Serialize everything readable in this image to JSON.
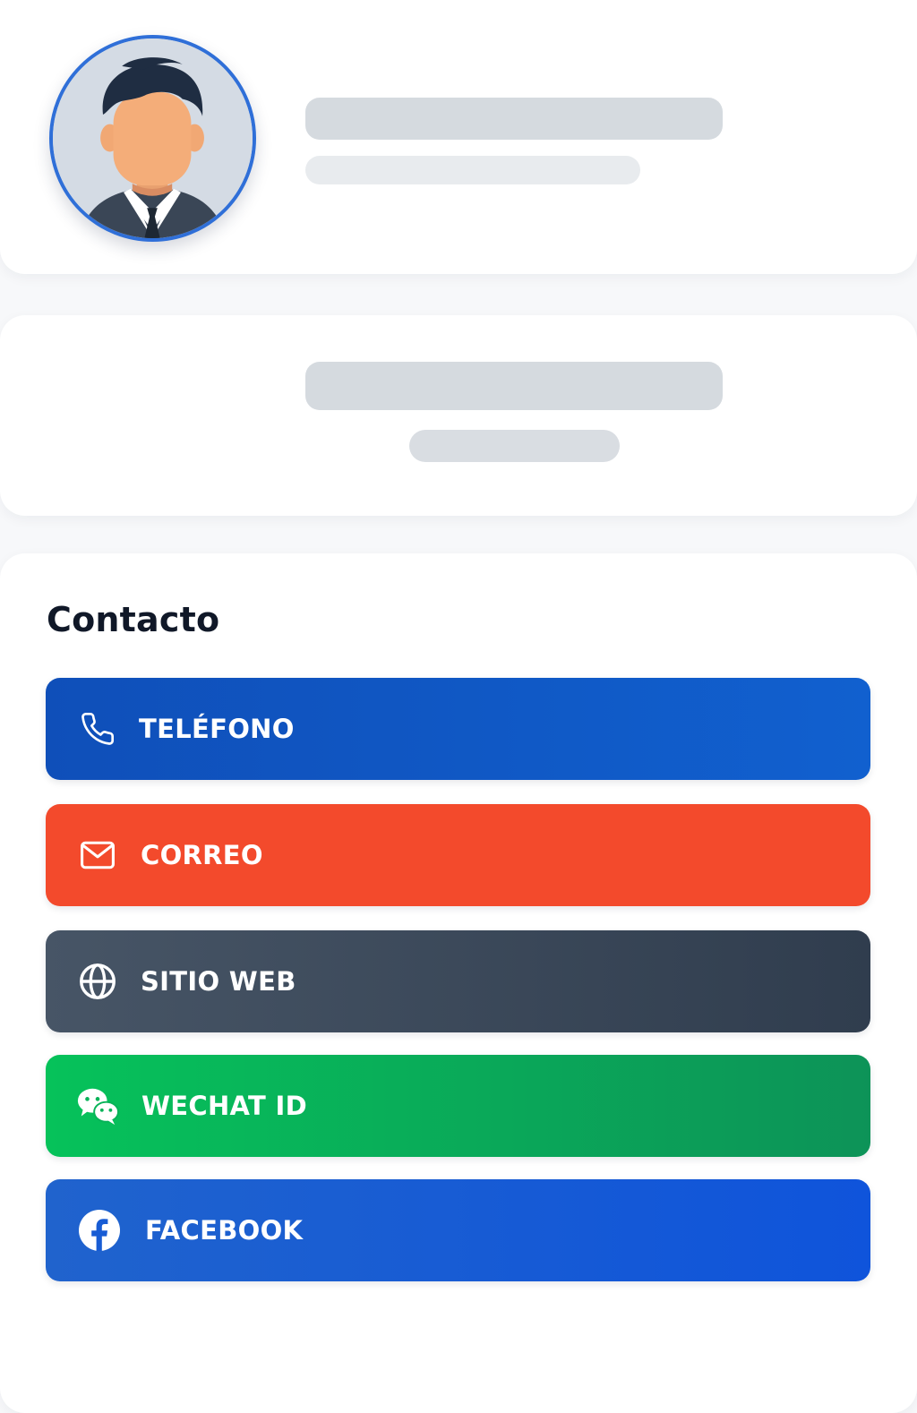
{
  "profile": {
    "avatar": "person-avatar",
    "accent_color": "#2f6fd8"
  },
  "contact": {
    "title": "Contacto",
    "buttons": [
      {
        "label": "TELÉFONO",
        "icon": "phone-icon",
        "color": "#0f55c2"
      },
      {
        "label": "CORREO",
        "icon": "mail-icon",
        "color": "#f34a2c"
      },
      {
        "label": "SITIO WEB",
        "icon": "globe-icon",
        "color": "#3d4a5b"
      },
      {
        "label": "WECHAT ID",
        "icon": "wechat-icon",
        "color": "#07b358"
      },
      {
        "label": "FACEBOOK",
        "icon": "facebook-icon",
        "color": "#185cd4"
      }
    ]
  }
}
